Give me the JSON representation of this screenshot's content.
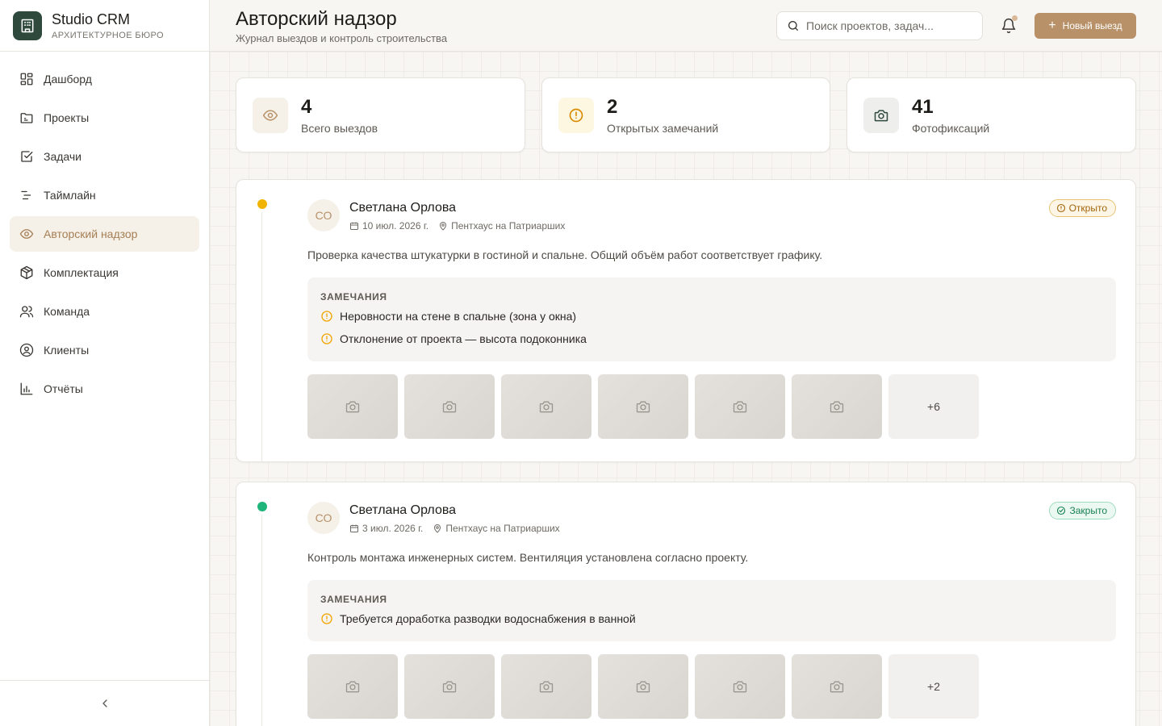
{
  "brand": {
    "name": "Studio CRM",
    "subtitle": "АРХИТЕКТУРНОЕ БЮРО"
  },
  "nav": [
    {
      "label": "Дашборд",
      "icon": "dashboard-icon"
    },
    {
      "label": "Проекты",
      "icon": "folder-icon"
    },
    {
      "label": "Задачи",
      "icon": "checkbox-icon"
    },
    {
      "label": "Таймлайн",
      "icon": "timeline-icon"
    },
    {
      "label": "Авторский надзор",
      "icon": "eye-icon",
      "active": true
    },
    {
      "label": "Комплектация",
      "icon": "box-icon"
    },
    {
      "label": "Команда",
      "icon": "users-icon"
    },
    {
      "label": "Клиенты",
      "icon": "user-circle-icon"
    },
    {
      "label": "Отчёты",
      "icon": "chart-icon"
    }
  ],
  "header": {
    "title": "Авторский надзор",
    "subtitle": "Журнал выездов и контроль строительства",
    "search_placeholder": "Поиск проектов, задач...",
    "new_button": "Новый выезд"
  },
  "stats": [
    {
      "value": "4",
      "label": "Всего выездов",
      "icon": "eye-icon"
    },
    {
      "value": "2",
      "label": "Открытых замечаний",
      "icon": "alert-circle-icon"
    },
    {
      "value": "41",
      "label": "Фотофиксаций",
      "icon": "camera-icon"
    }
  ],
  "visits": [
    {
      "initials": "СО",
      "author": "Светлана Орлова",
      "date": "10 июл. 2026 г.",
      "location": "Пентхаус на Патриарших",
      "status": "Открыто",
      "status_type": "open",
      "description": "Проверка качества штукатурки в гостиной и спальне. Общий объём работ соответствует графику.",
      "remarks_title": "ЗАМЕЧАНИЯ",
      "remarks": [
        "Неровности на стене в спальне (зона у окна)",
        "Отклонение от проекта — высота подоконника"
      ],
      "photo_more": "+6"
    },
    {
      "initials": "СО",
      "author": "Светлана Орлова",
      "date": "3 июл. 2026 г.",
      "location": "Пентхаус на Патриарших",
      "status": "Закрыто",
      "status_type": "closed",
      "description": "Контроль монтажа инженерных систем. Вентиляция установлена согласно проекту.",
      "remarks_title": "ЗАМЕЧАНИЯ",
      "remarks": [
        "Требуется доработка разводки водоснабжения в ванной"
      ],
      "photo_more": "+2"
    }
  ],
  "colors": {
    "accent": "#b89168",
    "brand_logo": "#2f4a3c",
    "open": "#f0b400",
    "closed": "#1fb57a"
  }
}
